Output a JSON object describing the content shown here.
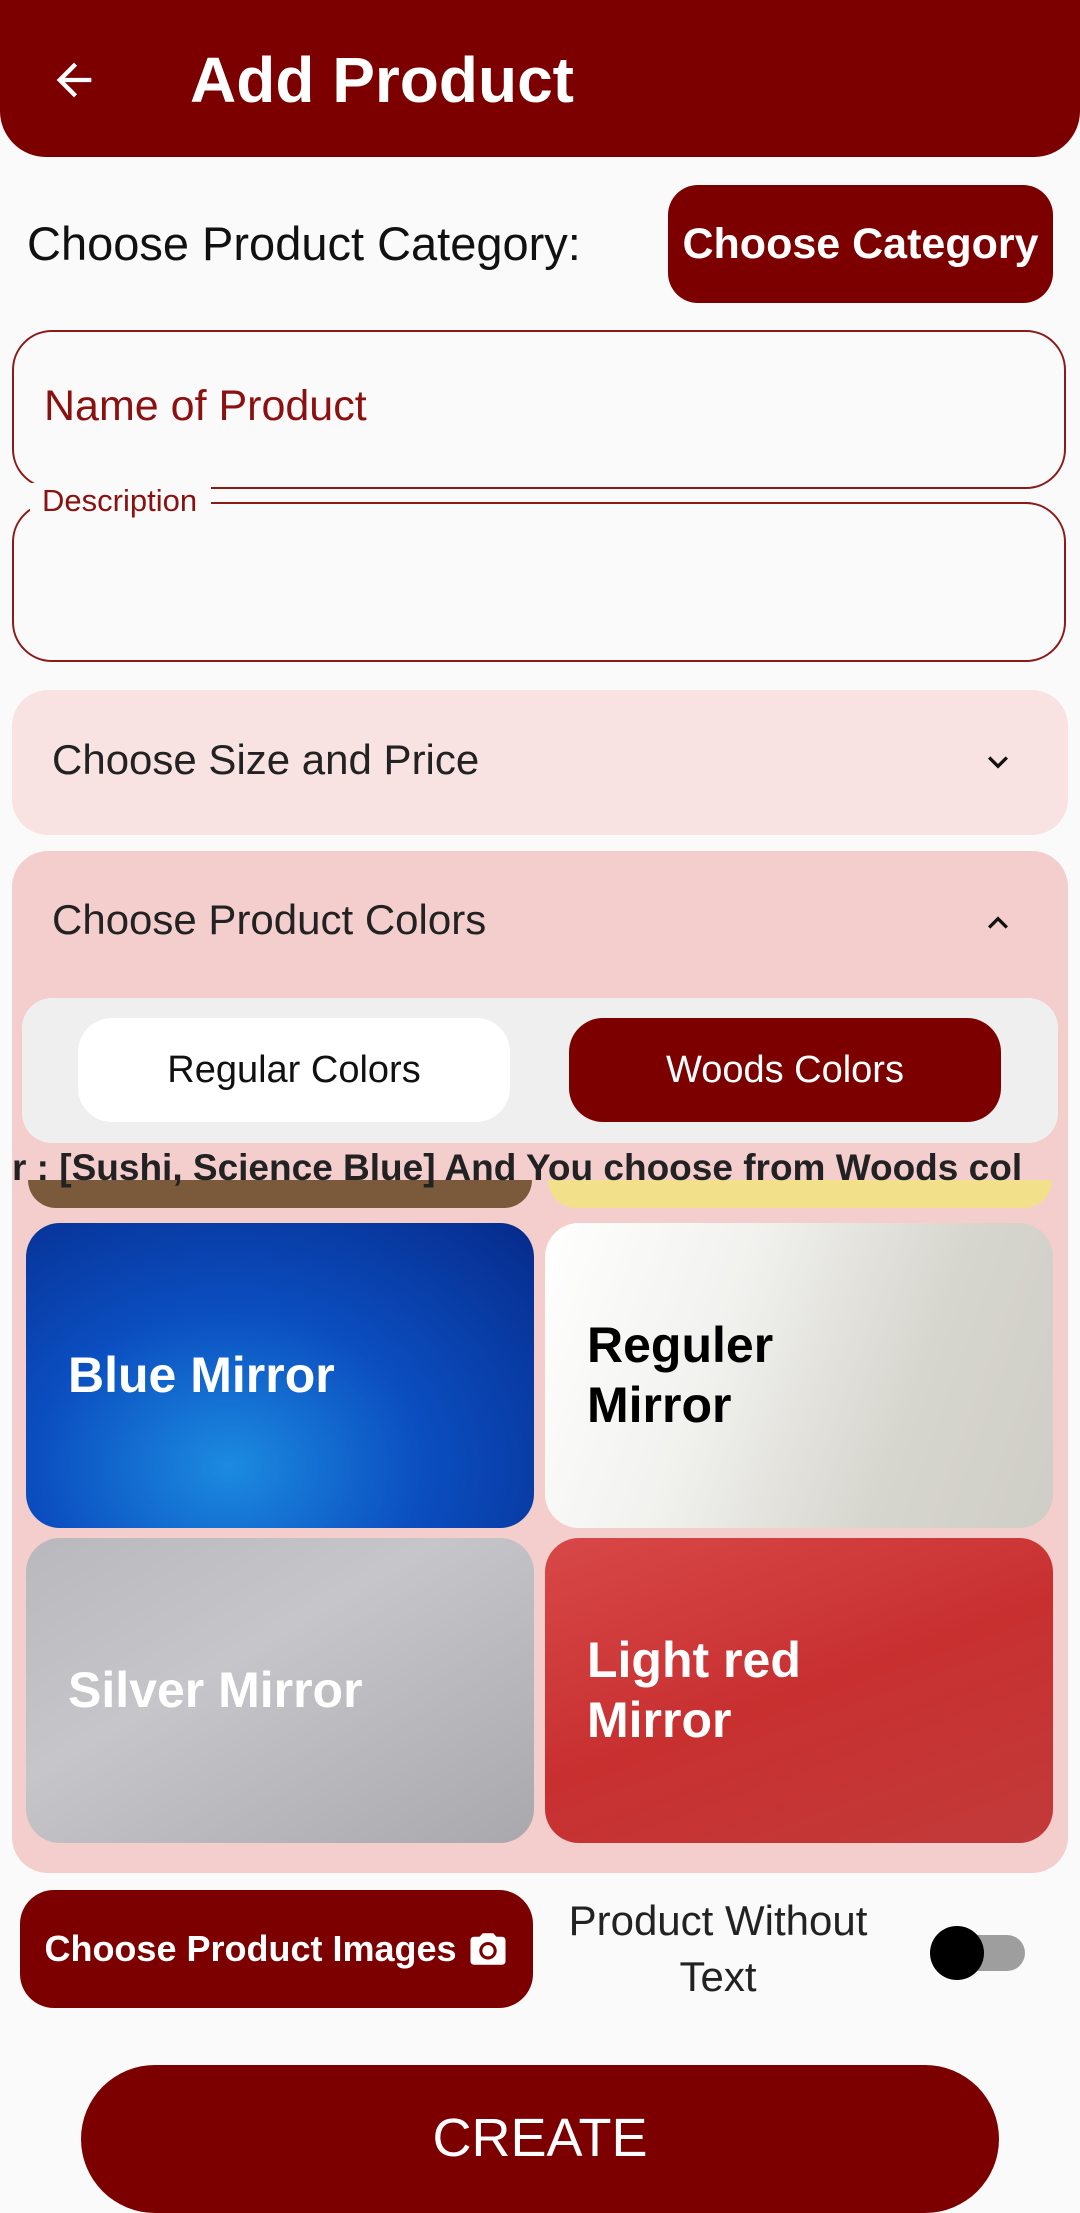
{
  "header": {
    "title": "Add Product",
    "back_icon": "arrow-left-icon"
  },
  "category": {
    "label": "Choose Product Category:",
    "button": "Choose Category"
  },
  "fields": {
    "name_placeholder": "Name of Product",
    "description_label": "Description",
    "description_value": ""
  },
  "size_panel": {
    "title": "Choose Size and Price",
    "expanded": false,
    "icon": "chevron-down-icon"
  },
  "colors_panel": {
    "title": "Choose Product Colors",
    "expanded": true,
    "icon": "chevron-up-icon",
    "tabs": [
      {
        "label": "Regular Colors",
        "selected": false
      },
      {
        "label": "Woods Colors",
        "selected": true
      }
    ],
    "marquee_text": "r : [Sushi, Science Blue]  And You choose from Woods col",
    "tiles": [
      {
        "label": "Blue Mirror",
        "color": "#0b4ec0",
        "text_color": "#ffffff"
      },
      {
        "label": "Reguler Mirror",
        "color": "#e6e5e0",
        "text_color": "#000000"
      },
      {
        "label": "Silver Mirror",
        "color": "#b8b8bd",
        "text_color": "#ffffff"
      },
      {
        "label": "Light red Mirror",
        "color": "#c83030",
        "text_color": "#ffffff"
      }
    ]
  },
  "images_button": {
    "label": "Choose Product Images",
    "icon": "camera-icon"
  },
  "without_text": {
    "label": "Product Without Text",
    "enabled": false
  },
  "create_button": {
    "label": "CREATE"
  },
  "colors": {
    "primary": "#7d0000",
    "panel_light": "#f8e2e2",
    "panel_colors": "#f4cdcd"
  }
}
